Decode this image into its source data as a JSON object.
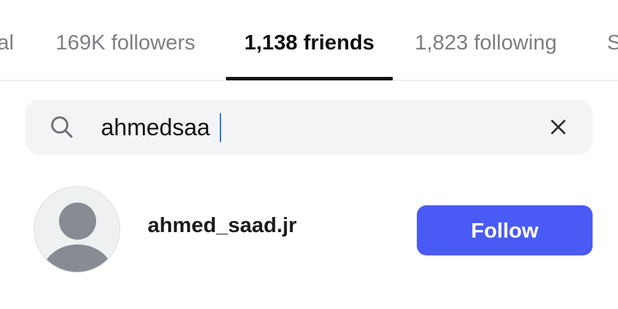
{
  "tabs": {
    "partial_left": "al",
    "followers": "169K followers",
    "friends": "1,138 friends",
    "following": "1,823 following",
    "partial_right": "S",
    "active": "friends"
  },
  "search": {
    "value": "ahmedsaa",
    "search_icon": "search-icon",
    "clear_icon": "close-icon"
  },
  "results": [
    {
      "username": "ahmed_saad.jr",
      "avatar": "default-avatar-icon",
      "follow_label": "Follow"
    }
  ],
  "colors": {
    "accent": "#4a5bf5",
    "active_tab": "#111214",
    "inactive_tab": "#7c7f85",
    "search_bg": "#f3f4f6",
    "caret": "#2b74e0"
  }
}
